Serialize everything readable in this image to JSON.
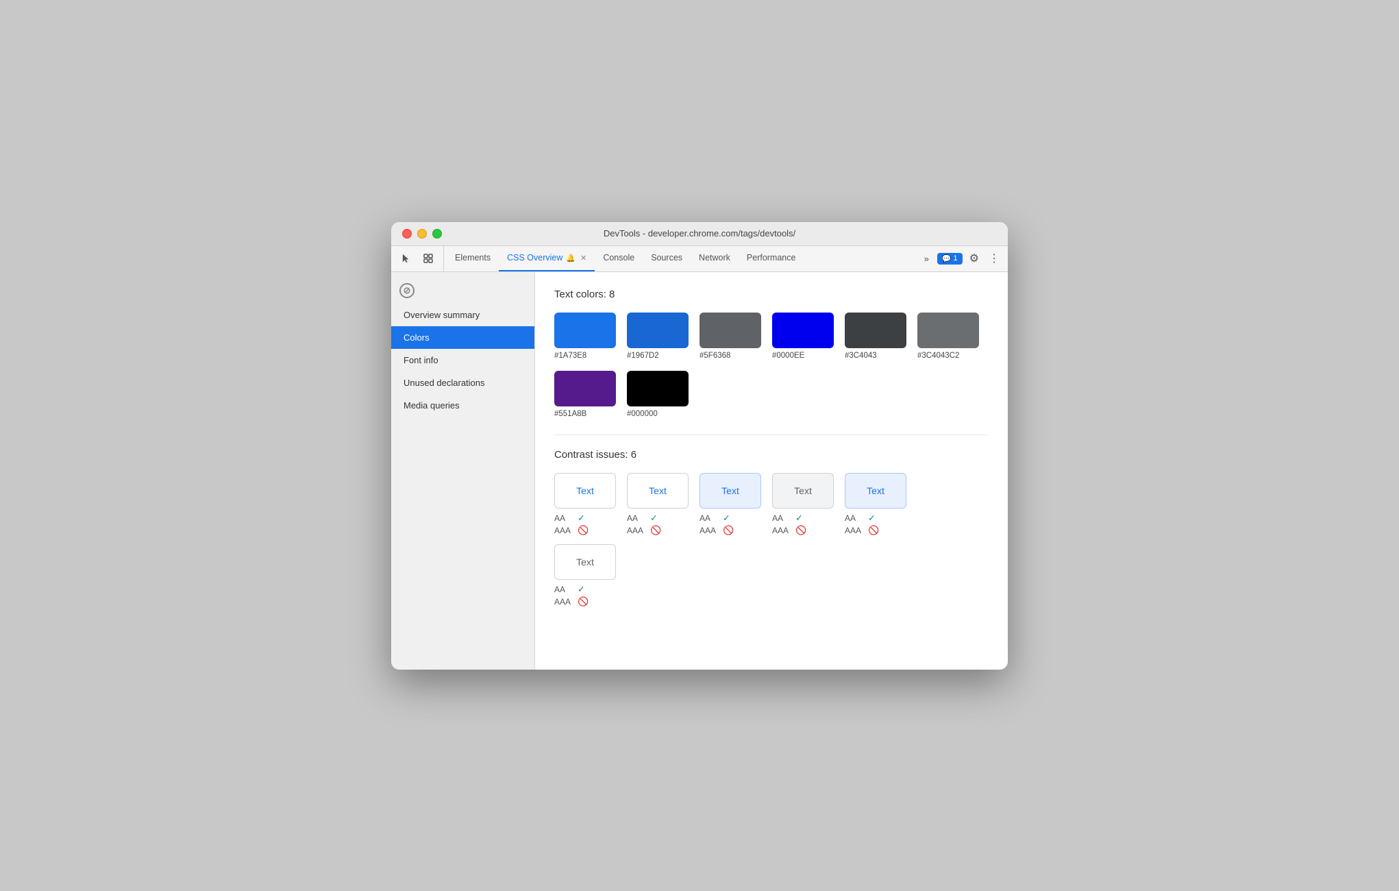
{
  "window": {
    "title": "DevTools - developer.chrome.com/tags/devtools/"
  },
  "titlebar": {
    "title": "DevTools - developer.chrome.com/tags/devtools/"
  },
  "toolbar": {
    "tabs": [
      {
        "id": "elements",
        "label": "Elements",
        "active": false
      },
      {
        "id": "css-overview",
        "label": "CSS Overview",
        "active": true,
        "hasIcon": true,
        "hasClose": true
      },
      {
        "id": "console",
        "label": "Console",
        "active": false
      },
      {
        "id": "sources",
        "label": "Sources",
        "active": false
      },
      {
        "id": "network",
        "label": "Network",
        "active": false
      },
      {
        "id": "performance",
        "label": "Performance",
        "active": false
      }
    ],
    "more_label": "»",
    "chat_count": "1",
    "gear_label": "⚙",
    "kebab_label": "⋮"
  },
  "sidebar": {
    "items": [
      {
        "id": "overview-summary",
        "label": "Overview summary",
        "active": false
      },
      {
        "id": "colors",
        "label": "Colors",
        "active": true
      },
      {
        "id": "font-info",
        "label": "Font info",
        "active": false
      },
      {
        "id": "unused-declarations",
        "label": "Unused declarations",
        "active": false
      },
      {
        "id": "media-queries",
        "label": "Media queries",
        "active": false
      }
    ]
  },
  "content": {
    "text_colors_title": "Text colors: 8",
    "colors": [
      {
        "hex": "#1A73E8",
        "bg": "#1A73E8"
      },
      {
        "hex": "#1967D2",
        "bg": "#1967D2"
      },
      {
        "hex": "#5F6368",
        "bg": "#5F6368"
      },
      {
        "hex": "#0000EE",
        "bg": "#0000EE"
      },
      {
        "hex": "#3C4043",
        "bg": "#3C4043"
      },
      {
        "hex": "#3C4043C2",
        "bg": "rgba(60,64,67,0.76)"
      },
      {
        "hex": "#551A8B",
        "bg": "#551A8B"
      },
      {
        "hex": "#000000",
        "bg": "#000000"
      }
    ],
    "contrast_issues_title": "Contrast issues: 6",
    "contrast_items": [
      {
        "label": "Text",
        "text_color": "#1A73E8",
        "bg_color": "#ffffff",
        "border_color": "#d0d0d0",
        "aa_pass": true,
        "aaa_pass": false
      },
      {
        "label": "Text",
        "text_color": "#1A73E8",
        "bg_color": "#ffffff",
        "border_color": "#d0d0d0",
        "aa_pass": true,
        "aaa_pass": false
      },
      {
        "label": "Text",
        "text_color": "#1A73E8",
        "bg_color": "#e8f0fe",
        "border_color": "#a8c7fa",
        "aa_pass": true,
        "aaa_pass": false
      },
      {
        "label": "Text",
        "text_color": "#5F6368",
        "bg_color": "#f1f3f4",
        "border_color": "#d0d0d0",
        "aa_pass": true,
        "aaa_pass": false
      },
      {
        "label": "Text",
        "text_color": "#1A73E8",
        "bg_color": "#e8f0fe",
        "border_color": "#a8c7fa",
        "aa_pass": true,
        "aaa_pass": false
      },
      {
        "label": "Text",
        "text_color": "#5F6368",
        "bg_color": "#ffffff",
        "border_color": "#d0d0d0",
        "aa_pass": true,
        "aaa_pass": false
      }
    ],
    "aa_label": "AA",
    "aaa_label": "AAA",
    "pass_icon": "✓",
    "fail_icon": "🚫"
  }
}
